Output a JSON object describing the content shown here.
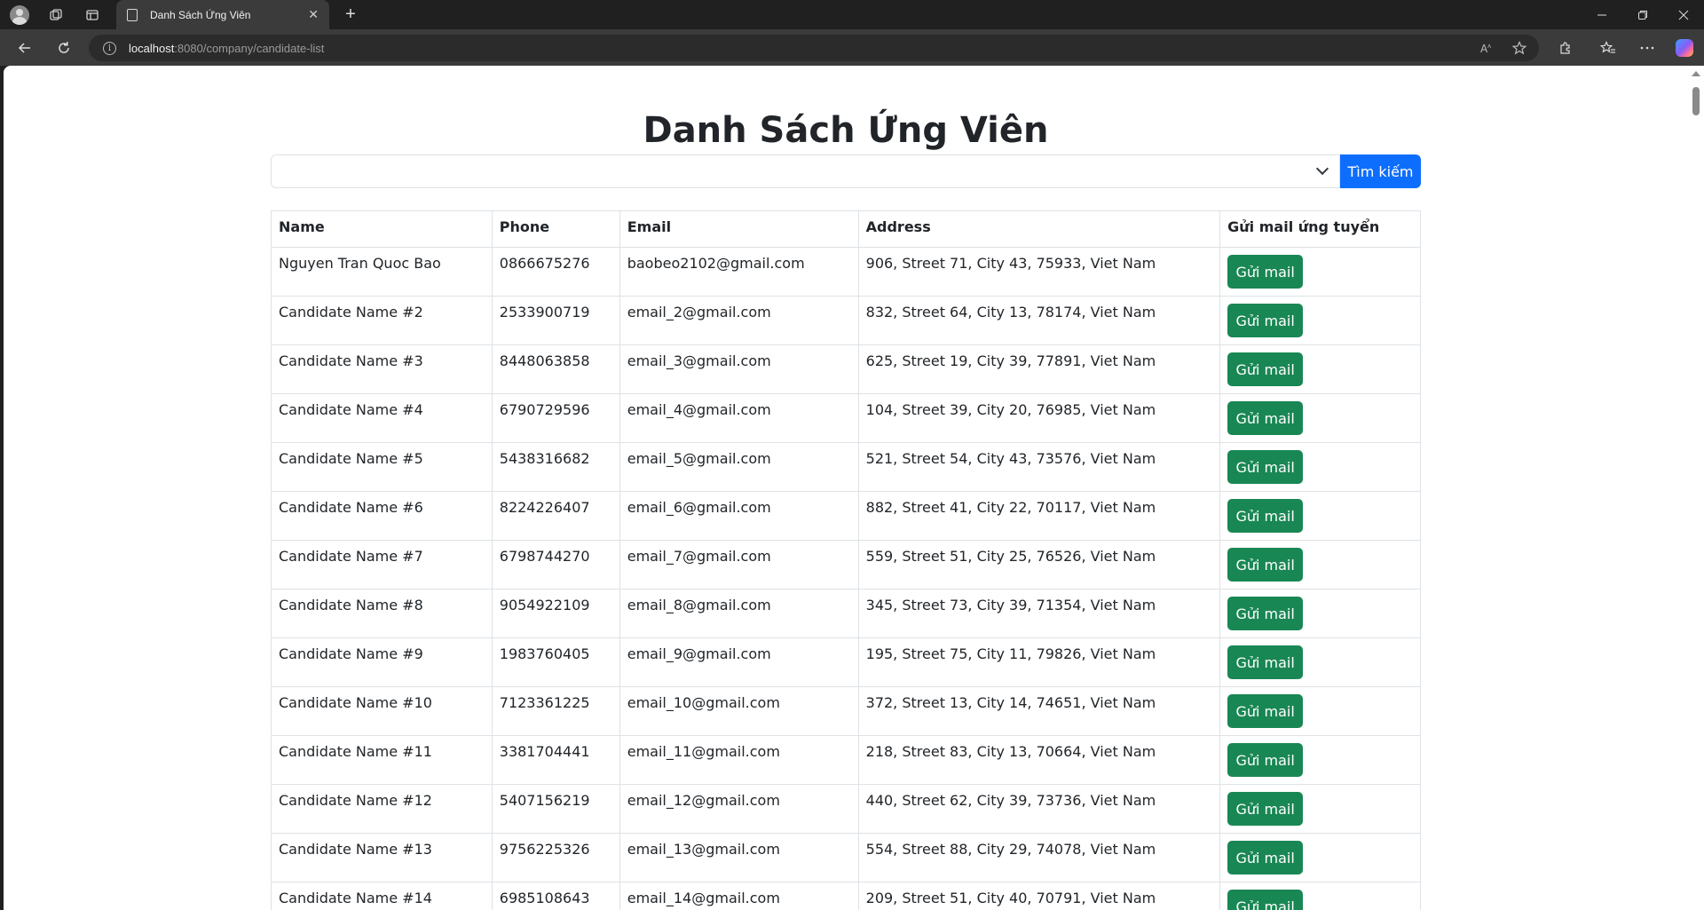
{
  "browser": {
    "tab_title": "Danh Sách Ứng Viên",
    "tab_close": "✕",
    "new_tab": "+",
    "url_host": "localhost",
    "url_rest": ":8080/company/candidate-list"
  },
  "page": {
    "title": "Danh Sách Ứng Viên",
    "search_button": "Tìm kiếm",
    "select_value": ""
  },
  "table": {
    "headers": {
      "name": "Name",
      "phone": "Phone",
      "email": "Email",
      "address": "Address",
      "action": "Gửi mail ứng tuyển"
    },
    "button_label": "Gửi mail",
    "rows": [
      {
        "name": "Nguyen Tran Quoc Bao",
        "phone": "0866675276",
        "email": "baobeo2102@gmail.com",
        "address": "906, Street 71, City 43, 75933, Viet Nam"
      },
      {
        "name": "Candidate Name #2",
        "phone": "2533900719",
        "email": "email_2@gmail.com",
        "address": "832, Street 64, City 13, 78174, Viet Nam"
      },
      {
        "name": "Candidate Name #3",
        "phone": "8448063858",
        "email": "email_3@gmail.com",
        "address": "625, Street 19, City 39, 77891, Viet Nam"
      },
      {
        "name": "Candidate Name #4",
        "phone": "6790729596",
        "email": "email_4@gmail.com",
        "address": "104, Street 39, City 20, 76985, Viet Nam"
      },
      {
        "name": "Candidate Name #5",
        "phone": "5438316682",
        "email": "email_5@gmail.com",
        "address": "521, Street 54, City 43, 73576, Viet Nam"
      },
      {
        "name": "Candidate Name #6",
        "phone": "8224226407",
        "email": "email_6@gmail.com",
        "address": "882, Street 41, City 22, 70117, Viet Nam"
      },
      {
        "name": "Candidate Name #7",
        "phone": "6798744270",
        "email": "email_7@gmail.com",
        "address": "559, Street 51, City 25, 76526, Viet Nam"
      },
      {
        "name": "Candidate Name #8",
        "phone": "9054922109",
        "email": "email_8@gmail.com",
        "address": "345, Street 73, City 39, 71354, Viet Nam"
      },
      {
        "name": "Candidate Name #9",
        "phone": "1983760405",
        "email": "email_9@gmail.com",
        "address": "195, Street 75, City 11, 79826, Viet Nam"
      },
      {
        "name": "Candidate Name #10",
        "phone": "7123361225",
        "email": "email_10@gmail.com",
        "address": "372, Street 13, City 14, 74651, Viet Nam"
      },
      {
        "name": "Candidate Name #11",
        "phone": "3381704441",
        "email": "email_11@gmail.com",
        "address": "218, Street 83, City 13, 70664, Viet Nam"
      },
      {
        "name": "Candidate Name #12",
        "phone": "5407156219",
        "email": "email_12@gmail.com",
        "address": "440, Street 62, City 39, 73736, Viet Nam"
      },
      {
        "name": "Candidate Name #13",
        "phone": "9756225326",
        "email": "email_13@gmail.com",
        "address": "554, Street 88, City 29, 74078, Viet Nam"
      },
      {
        "name": "Candidate Name #14",
        "phone": "6985108643",
        "email": "email_14@gmail.com",
        "address": "209, Street 51, City 40, 70791, Viet Nam"
      }
    ]
  },
  "colors": {
    "primary": "#0d6efd",
    "success": "#198754"
  }
}
